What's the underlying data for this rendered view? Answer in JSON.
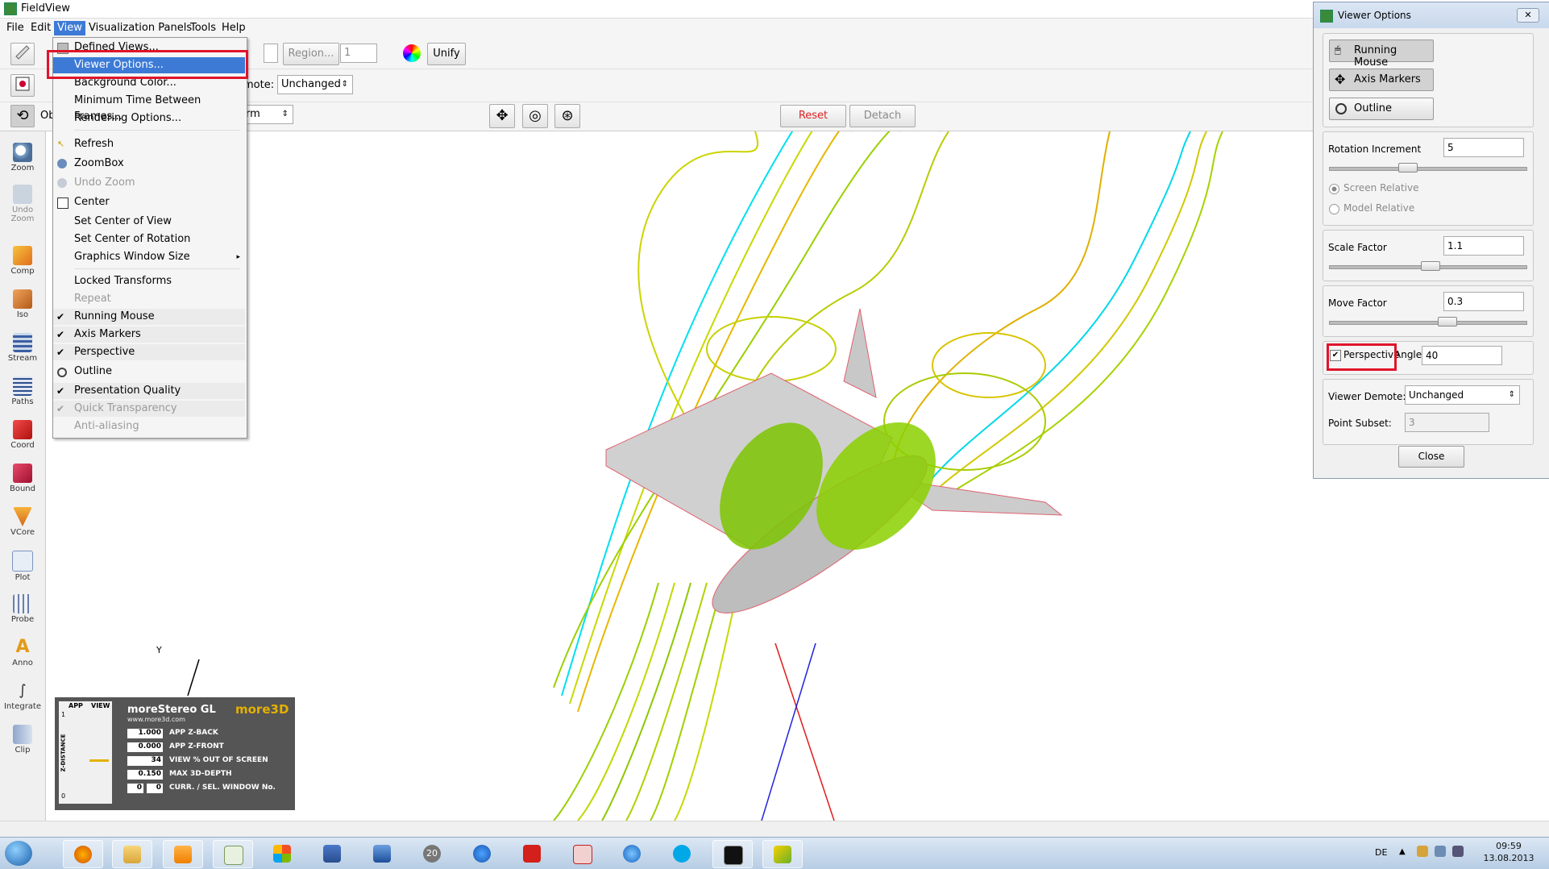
{
  "window": {
    "title": "FieldView"
  },
  "menubar": {
    "items": [
      "File",
      "Edit",
      "View",
      "Visualization Panels",
      "Tools",
      "Help"
    ],
    "active": "View"
  },
  "toolbar": {
    "region_button": "Region...",
    "region_value": "1",
    "unify_button": "Unify",
    "demote_label": "mote:",
    "demote_value": "Unchanged",
    "obj_label": "Ob",
    "transform_value": "rm",
    "reset_button": "Reset",
    "detach_button": "Detach"
  },
  "left_tools": [
    "Zoom",
    "Undo Zoom",
    "Comp",
    "Iso",
    "Stream",
    "Paths",
    "Coord",
    "Bound",
    "VCore",
    "Plot",
    "Probe",
    "Anno",
    "Integrate",
    "Clip"
  ],
  "view_menu": {
    "items": [
      {
        "label": "Defined Views..."
      },
      {
        "label": "Viewer Options..."
      },
      {
        "label": "Background Color..."
      },
      {
        "label": "Minimum Time Between Frames..."
      },
      {
        "label": "Rendering Options..."
      },
      {
        "label": "Refresh"
      },
      {
        "label": "ZoomBox"
      },
      {
        "label": "Undo Zoom"
      },
      {
        "label": "Center"
      },
      {
        "label": "Set Center of View"
      },
      {
        "label": "Set Center of Rotation"
      },
      {
        "label": "Graphics Window Size"
      },
      {
        "label": "Locked Transforms"
      },
      {
        "label": "Repeat"
      },
      {
        "label": "Running Mouse"
      },
      {
        "label": "Axis Markers"
      },
      {
        "label": "Perspective"
      },
      {
        "label": "Outline"
      },
      {
        "label": "Presentation Quality"
      },
      {
        "label": "Quick Transparency"
      },
      {
        "label": "Anti-aliasing"
      }
    ]
  },
  "viewer_options": {
    "title": "Viewer Options",
    "buttons": [
      "Running Mouse",
      "Axis Markers",
      "Outline"
    ],
    "rotation_increment_label": "Rotation Increment",
    "rotation_increment_value": "5",
    "screen_relative": "Screen Relative",
    "model_relative": "Model Relative",
    "scale_factor_label": "Scale Factor",
    "scale_factor_value": "1.1",
    "move_factor_label": "Move Factor",
    "move_factor_value": "0.3",
    "perspective_label": "Perspective",
    "angle_label": "Angle:",
    "angle_value": "40",
    "viewer_demote_label": "Viewer Demote:",
    "viewer_demote_value": "Unchanged",
    "point_subset_label": "Point Subset:",
    "point_subset_value": "3",
    "close_button": "Close"
  },
  "stereo_overlay": {
    "brand": "moreStereo GL",
    "logo": "more3D",
    "url": "www.more3d.com",
    "app_label": "APP",
    "view_label": "VIEW",
    "zdist_label": "Z-DISTANCE",
    "rows": [
      {
        "value": "1.000",
        "label": "APP Z-BACK"
      },
      {
        "value": "0.000",
        "label": "APP Z-FRONT"
      },
      {
        "value": "34",
        "label": "VIEW % OUT OF SCREEN"
      },
      {
        "value": "0.150",
        "label": "MAX 3D-DEPTH"
      }
    ],
    "window_values": [
      "0",
      "0"
    ],
    "window_label": "CURR. / SEL. WINDOW No.",
    "scale_top": "1",
    "scale_bottom": "0"
  },
  "axis": {
    "y_label": "Y"
  },
  "taskbar": {
    "lang": "DE",
    "time": "09:59",
    "date": "13.08.2013",
    "badge": "20"
  }
}
